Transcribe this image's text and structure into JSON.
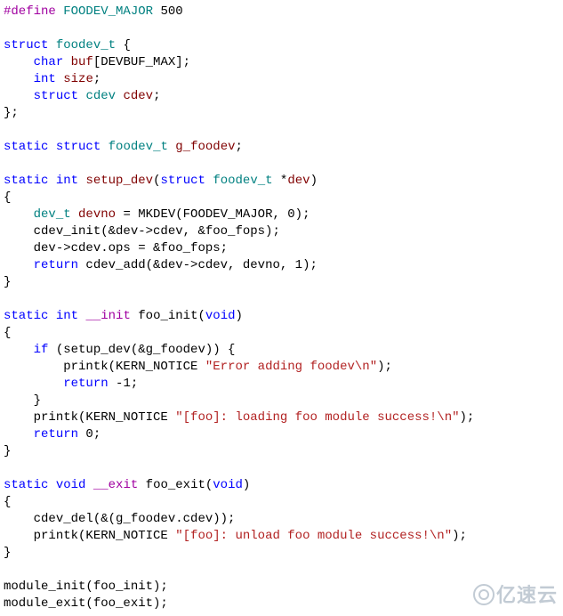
{
  "code": {
    "l01": {
      "define": "#define",
      "macro": "FOODEV_MAJOR",
      "val": "500"
    },
    "l02": {
      "kw_struct": "struct",
      "ty": "foodev_t",
      "brace": " {"
    },
    "l03": {
      "indent": "    ",
      "kw": "char",
      "id": "buf",
      "rest": "[DEVBUF_MAX];"
    },
    "l04": {
      "indent": "    ",
      "kw": "int",
      "id": "size",
      "rest": ";"
    },
    "l05": {
      "indent": "    ",
      "kw": "struct",
      "ty": "cdev",
      "id": "cdev",
      "rest": ";"
    },
    "l06": {
      "text": "};"
    },
    "l07": {
      "kw1": "static",
      "kw2": "struct",
      "ty": "foodev_t",
      "id": "g_foodev",
      "rest": ";"
    },
    "l08": {
      "kw1": "static",
      "kw2": "int",
      "fn": "setup_dev",
      "lp": "(",
      "kw3": "struct",
      "ty": "foodev_t",
      "star": " *",
      "arg": "dev",
      "rp": ")"
    },
    "l09": {
      "text": "{"
    },
    "l10": {
      "indent": "    ",
      "ty": "dev_t",
      "id": "devno",
      "rest": " = MKDEV(FOODEV_MAJOR, 0);"
    },
    "l11": {
      "indent": "    ",
      "text": "cdev_init(&dev->cdev, &foo_fops);"
    },
    "l12": {
      "indent": "    ",
      "text": "dev->cdev.ops = &foo_fops;"
    },
    "l13": {
      "indent": "    ",
      "kw": "return",
      "rest": " cdev_add(&dev->cdev, devno, 1);"
    },
    "l14": {
      "text": "}"
    },
    "l15": {
      "kw1": "static",
      "kw2": "int",
      "attr": "__init",
      "rest": " foo_init(",
      "kw3": "void",
      "rp": ")"
    },
    "l16": {
      "text": "{"
    },
    "l17": {
      "indent": "    ",
      "kw": "if",
      "rest": " (setup_dev(&g_foodev)) {"
    },
    "l18": {
      "indent": "        ",
      "pre": "printk(KERN_NOTICE ",
      "str": "\"Error adding foodev\\n\"",
      "post": ");"
    },
    "l19": {
      "indent": "        ",
      "kw": "return",
      "rest": " -1;"
    },
    "l20": {
      "indent": "    ",
      "text": "}"
    },
    "l21": {
      "indent": "    ",
      "pre": "printk(KERN_NOTICE ",
      "str": "\"[foo]: loading foo module success!\\n\"",
      "post": ");"
    },
    "l22": {
      "indent": "    ",
      "kw": "return",
      "rest": " 0;"
    },
    "l23": {
      "text": "}"
    },
    "l24": {
      "kw1": "static",
      "kw2": "void",
      "attr": "__exit",
      "rest": " foo_exit(",
      "kw3": "void",
      "rp": ")"
    },
    "l25": {
      "text": "{"
    },
    "l26": {
      "indent": "    ",
      "text": "cdev_del(&(g_foodev.cdev));"
    },
    "l27": {
      "indent": "    ",
      "pre": "printk(KERN_NOTICE ",
      "str": "\"[foo]: unload foo module success!\\n\"",
      "post": ");"
    },
    "l28": {
      "text": "}"
    },
    "l29": {
      "text": "module_init(foo_init);"
    },
    "l30": {
      "text": "module_exit(foo_exit);"
    }
  },
  "watermark": "亿速云"
}
